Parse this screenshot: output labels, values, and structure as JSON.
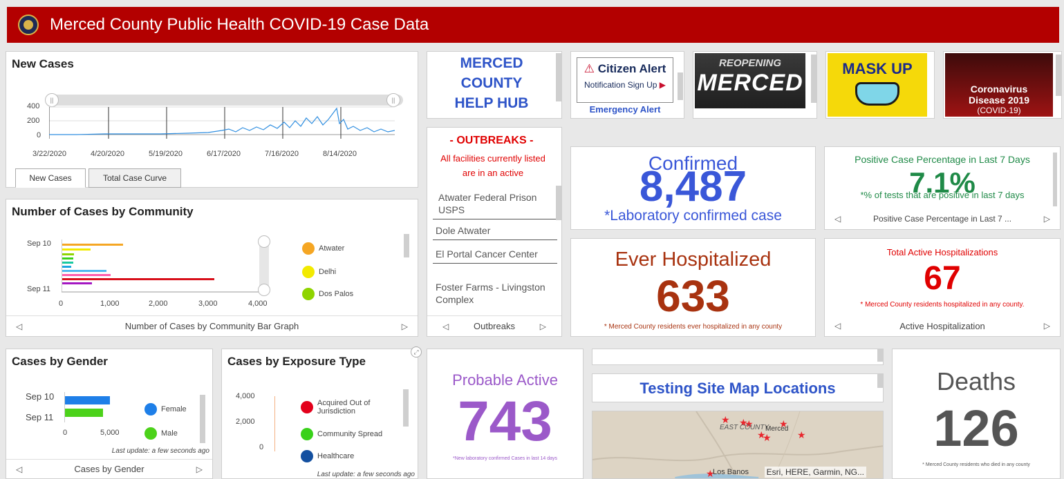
{
  "header": {
    "title": "Merced County Public Health COVID-19 Case Data"
  },
  "new_cases": {
    "title": "New Cases",
    "tabs": [
      "New Cases",
      "Total Case Curve"
    ],
    "x_ticks": [
      "3/22/2020",
      "4/20/2020",
      "5/19/2020",
      "6/17/2020",
      "7/16/2020",
      "8/14/2020"
    ],
    "y_ticks": [
      "400",
      "200",
      "0"
    ],
    "slider_handle_label": "||"
  },
  "community": {
    "title": "Number of Cases by Community",
    "y_ticks": [
      "Sep 10",
      "Sep 11"
    ],
    "x_ticks": [
      "0",
      "1,000",
      "2,000",
      "3,000",
      "4,000"
    ],
    "legend": [
      {
        "name": "Atwater",
        "color": "#f5a623"
      },
      {
        "name": "Delhi",
        "color": "#f2ea00"
      },
      {
        "name": "Dos Palos",
        "color": "#8fd400"
      }
    ],
    "footer": "Number of Cases by Community Bar Graph"
  },
  "gender": {
    "title": "Cases by Gender",
    "y_ticks": [
      "Sep 10",
      "Sep 11"
    ],
    "x_ticks": [
      "0",
      "5,000"
    ],
    "legend": [
      {
        "name": "Female",
        "color": "#1e7fe8"
      },
      {
        "name": "Male",
        "color": "#4cd21a"
      }
    ],
    "last_update": "Last update: a few seconds ago",
    "footer": "Cases by Gender"
  },
  "exposure": {
    "title": "Cases by Exposure Type",
    "y_ticks": [
      "4,000",
      "2,000",
      "0"
    ],
    "legend": [
      {
        "name": "Acquired Out of Jurisdiction",
        "color": "#e3001b"
      },
      {
        "name": "Community Spread",
        "color": "#39d11a"
      },
      {
        "name": "Healthcare",
        "color": "#1450a0"
      }
    ],
    "last_update": "Last update: a few seconds ago"
  },
  "help_hub": {
    "line1": "MERCED",
    "line2": "COUNTY",
    "line3": "HELP HUB"
  },
  "citizen_alert": {
    "title": "Citizen Alert",
    "subtitle": "Notification Sign Up",
    "link": "Emergency Alert"
  },
  "reopening": {
    "line1": "REOPENING",
    "line2": "MERCED"
  },
  "mask_up": {
    "text": "MASK UP"
  },
  "coronavirus": {
    "line1": "Coronavirus",
    "line2": "Disease 2019",
    "line3": "(COVID-19)"
  },
  "outbreaks": {
    "heading": "- OUTBREAKS -",
    "note": "All facilities currently listed are in an active",
    "items": [
      "Atwater Federal Prison USPS",
      "Dole Atwater",
      "El Portal Cancer Center",
      "Foster Farms - Livingston Complex"
    ],
    "footer": "Outbreaks"
  },
  "confirmed": {
    "label": "Confirmed",
    "value": "8,487",
    "note": "*Laboratory confirmed case",
    "color": "#3a57d8"
  },
  "positive": {
    "label": "Positive Case Percentage in Last 7 Days",
    "value": "7.1%",
    "note": "*% of tests that are positive in last 7 days",
    "footer": "Positive Case Percentage in Last 7 ...",
    "color": "#1f8a47"
  },
  "hospitalized": {
    "label": "Ever Hospitalized",
    "value": "633",
    "note": "* Merced County residents ever hospitalized in any county",
    "color": "#a8320f"
  },
  "active_hosp": {
    "label": "Total Active Hospitalizations",
    "value": "67",
    "note": "* Merced County residents hospitalized in any county.",
    "footer": "Active Hospitalization",
    "color": "#e00000"
  },
  "probable": {
    "label": "Probable Active",
    "value": "743",
    "note": "*New laboratory confirmed Cases in last 14 days",
    "color": "#9b59c9"
  },
  "testing": {
    "title": "Testing Site Map Locations",
    "map_labels": [
      "EAST COUNTY",
      "Merced",
      "Los Banos"
    ],
    "attribution": "Esri, HERE, Garmin, NG..."
  },
  "deaths": {
    "label": "Deaths",
    "value": "126",
    "note": "* Merced County residents who died in any county",
    "color": "#555555"
  }
}
